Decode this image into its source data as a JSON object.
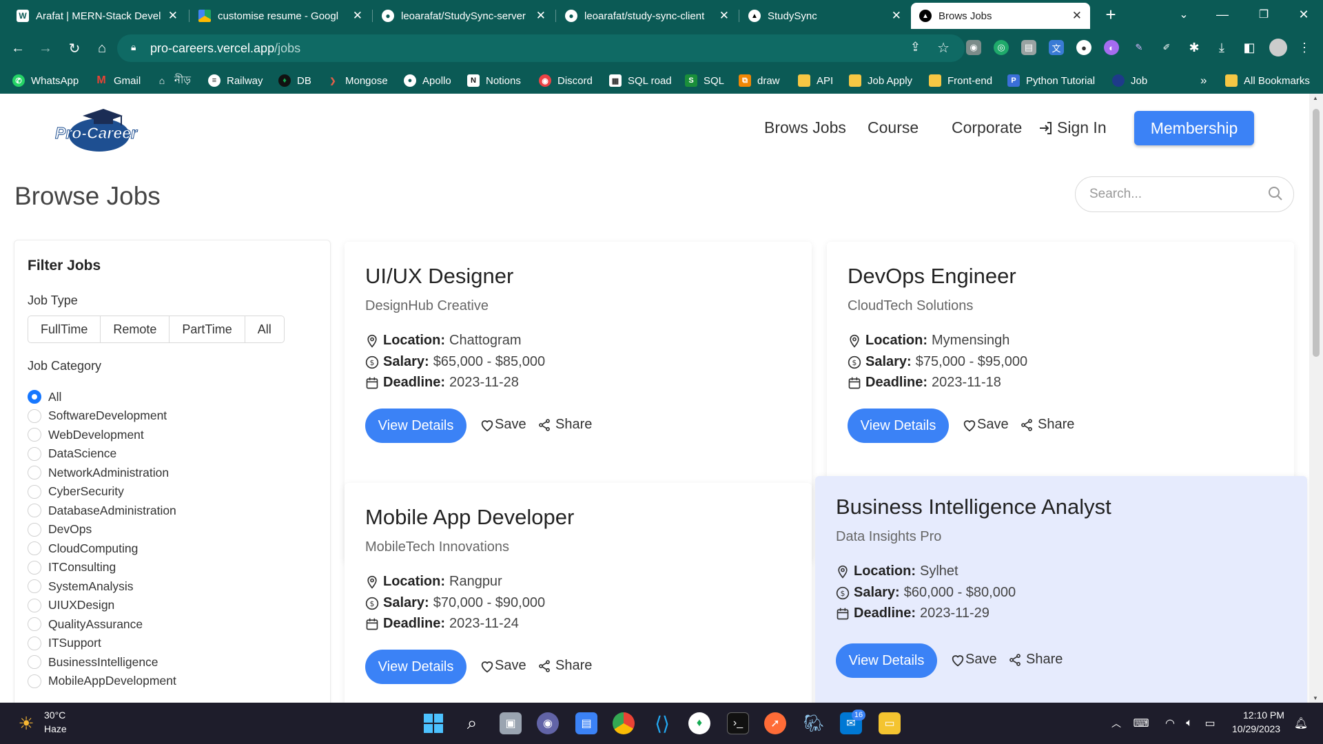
{
  "browser": {
    "tabs": [
      {
        "title": "Arafat | MERN-Stack Devel",
        "icon": "portfolio-icon"
      },
      {
        "title": "customise resume - Googl",
        "icon": "google-drive-icon"
      },
      {
        "title": "leoarafat/StudySync-server",
        "icon": "github-icon"
      },
      {
        "title": "leoarafat/study-sync-client",
        "icon": "github-icon"
      },
      {
        "title": "StudySync",
        "icon": "vercel-icon"
      },
      {
        "title": "Brows Jobs",
        "icon": "vercel-icon",
        "active": true
      }
    ],
    "url_host": "pro-careers.vercel.app",
    "url_path": "/jobs",
    "bookmarks": [
      {
        "label": "WhatsApp",
        "color": "#25d366"
      },
      {
        "label": "Gmail",
        "color": "#ea4335"
      },
      {
        "label": "নীড়",
        "color": "#444444"
      },
      {
        "label": "Railway",
        "color": "#222222"
      },
      {
        "label": "DB",
        "color": "#13aa52"
      },
      {
        "label": "Mongose",
        "color": "#880000"
      },
      {
        "label": "Apollo",
        "color": "#222222"
      },
      {
        "label": "Notions",
        "color": "#222222"
      },
      {
        "label": "Discord",
        "color": "#5865f2"
      },
      {
        "label": "SQL road",
        "color": "#444444"
      },
      {
        "label": "SQL",
        "color": "#1a8f3a"
      },
      {
        "label": "draw",
        "color": "#f08705"
      },
      {
        "label": "API",
        "color": "#f6c744"
      },
      {
        "label": "Job Apply",
        "color": "#f6c744"
      },
      {
        "label": "Front-end",
        "color": "#f6c744"
      },
      {
        "label": "Python Tutorial",
        "color": "#3b6fd9"
      },
      {
        "label": "Job",
        "color": "#1e3a8a"
      }
    ],
    "bookmarks_overflow": "»",
    "all_bookmarks": "All Bookmarks"
  },
  "header": {
    "logo_text": "Pro-Career",
    "nav": [
      "Brows Jobs",
      "Course",
      "Corporate",
      "Sign In"
    ],
    "membership": "Membership"
  },
  "main": {
    "title": "Browse Jobs",
    "search_placeholder": "Search..."
  },
  "filter": {
    "title": "Filter Jobs",
    "job_type_label": "Job Type",
    "job_types": [
      "FullTime",
      "Remote",
      "PartTime",
      "All"
    ],
    "category_label": "Job Category",
    "categories": [
      "All",
      "SoftwareDevelopment",
      "WebDevelopment",
      "DataScience",
      "NetworkAdministration",
      "CyberSecurity",
      "DatabaseAdministration",
      "DevOps",
      "CloudComputing",
      "ITConsulting",
      "SystemAnalysis",
      "UIUXDesign",
      "QualityAssurance",
      "ITSupport",
      "BusinessIntelligence",
      "MobileAppDevelopment"
    ],
    "selected_category": "All"
  },
  "labels": {
    "location": "Location:",
    "salary": "Salary:",
    "deadline": "Deadline:",
    "view_details": "View Details",
    "save": "Save",
    "share": "Share"
  },
  "jobs": [
    {
      "title": "UI/UX Designer",
      "company": "DesignHub Creative",
      "location": "Chattogram",
      "salary": "$65,000 - $85,000",
      "deadline": "2023-11-28"
    },
    {
      "title": "DevOps Engineer",
      "company": "CloudTech Solutions",
      "location": "Mymensingh",
      "salary": "$75,000 - $95,000",
      "deadline": "2023-11-18"
    },
    {
      "title": "Mobile App Developer",
      "company": "MobileTech Innovations",
      "location": "Rangpur",
      "salary": "$70,000 - $90,000",
      "deadline": "2023-11-24"
    },
    {
      "title": "Business Intelligence Analyst",
      "company": "Data Insights Pro",
      "location": "Sylhet",
      "salary": "$60,000 - $80,000",
      "deadline": "2023-11-29",
      "highlighted": true
    }
  ],
  "taskbar": {
    "weather_temp": "30°C",
    "weather_desc": "Haze",
    "time": "12:10 PM",
    "date": "10/29/2023",
    "mail_badge": "16"
  }
}
